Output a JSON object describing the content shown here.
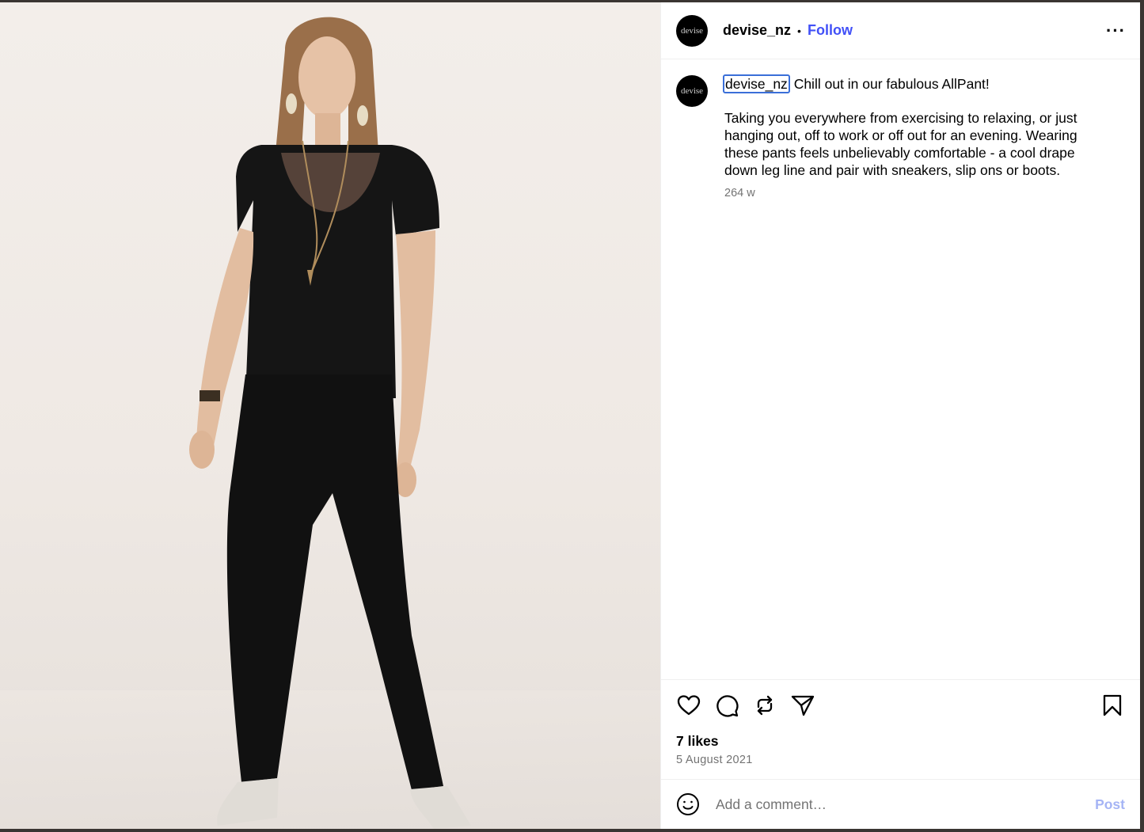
{
  "account": {
    "username": "devise_nz",
    "avatar_text": "devise",
    "follow_label": "Follow",
    "separator": "•",
    "more_label": "···"
  },
  "caption": {
    "username": "devise_nz",
    "headline": "Chill out in our fabulous AllPant!",
    "body": "Taking you everywhere from exercising to relaxing, or just hanging out, off to work or off out for an evening. Wearing these pants feels unbelievably comfortable - a cool drape down leg line and pair with sneakers, slip ons or boots.",
    "age": "264 w"
  },
  "actions": {
    "icons": [
      "heart-icon",
      "comment-icon",
      "repost-icon",
      "share-icon",
      "bookmark-icon"
    ]
  },
  "stats": {
    "likes": "7 likes",
    "date": "5 August 2021"
  },
  "comment_box": {
    "placeholder": "Add a comment…",
    "post_label": "Post"
  },
  "colors": {
    "follow": "#4150f7",
    "post_disabled": "#a5b4f5",
    "secondary_text": "#737373",
    "focus_outline": "#3a6fd8"
  }
}
